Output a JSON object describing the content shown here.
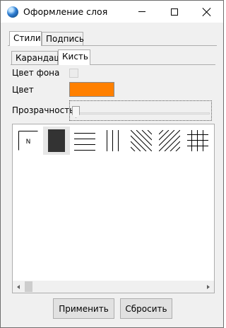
{
  "window": {
    "title": "Оформление слоя"
  },
  "tabs_outer": [
    {
      "label": "Стили",
      "active": true
    },
    {
      "label": "Подпись",
      "active": false
    }
  ],
  "tabs_inner": [
    {
      "label": "Карандаш",
      "active": false
    },
    {
      "label": "Кисть",
      "active": true
    }
  ],
  "brush": {
    "bg_color_label": "Цвет фона",
    "bg_color_checked": false,
    "color_label": "Цвет",
    "color_value": "#ff8000",
    "opacity_label": "Прозрачность",
    "opacity_value": 0
  },
  "patterns": [
    {
      "name": "none",
      "label": "N",
      "selected": false
    },
    {
      "name": "solid",
      "selected": true
    },
    {
      "name": "horizontal",
      "selected": false
    },
    {
      "name": "vertical",
      "selected": false
    },
    {
      "name": "backward-diagonal",
      "selected": false
    },
    {
      "name": "forward-diagonal",
      "selected": false
    },
    {
      "name": "cross",
      "selected": false
    },
    {
      "name": "diagonal-cross",
      "selected": false
    }
  ],
  "buttons": {
    "apply": "Применить",
    "reset": "Сбросить"
  }
}
